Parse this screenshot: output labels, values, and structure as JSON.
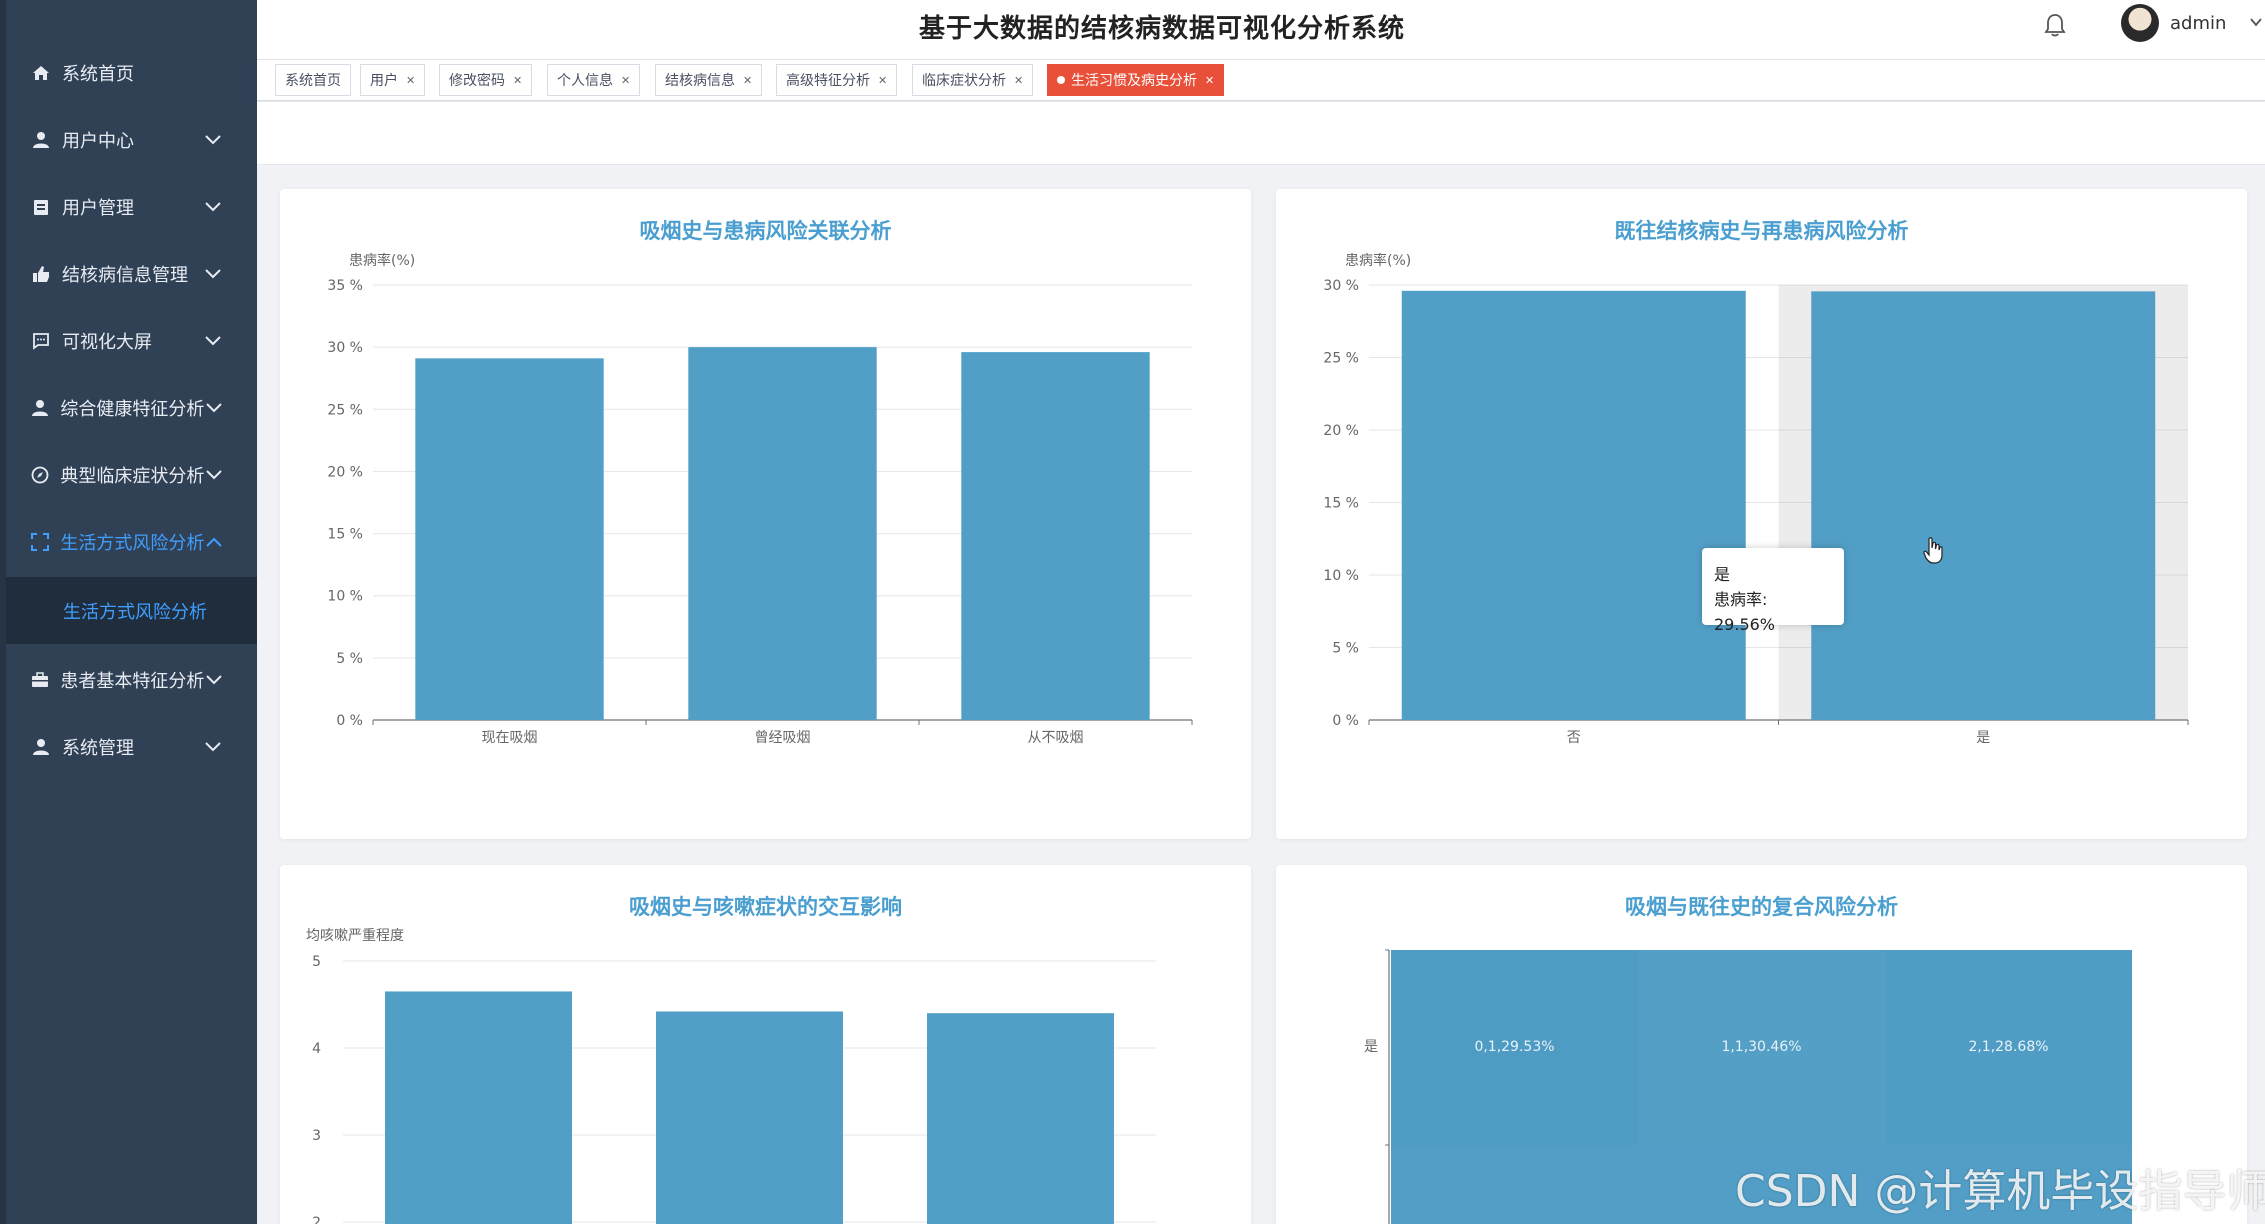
{
  "header": {
    "title": "基于大数据的结核病数据可视化分析系统",
    "username": "admin"
  },
  "sidebar": {
    "items": [
      {
        "label": "系统首页",
        "icon": "home-icon"
      },
      {
        "label": "用户中心",
        "icon": "user-icon"
      },
      {
        "label": "用户管理",
        "icon": "clipboard-icon"
      },
      {
        "label": "结核病信息管理",
        "icon": "thumb-icon"
      },
      {
        "label": "可视化大屏",
        "icon": "message-icon"
      },
      {
        "label": "综合健康特征分析",
        "icon": "user-icon"
      },
      {
        "label": "典型临床症状分析",
        "icon": "compass-icon"
      },
      {
        "label": "生活方式风险分析",
        "icon": "fullscreen-icon"
      },
      {
        "label": "患者基本特征分析",
        "icon": "suitcase-icon"
      },
      {
        "label": "系统管理",
        "icon": "user-icon"
      }
    ],
    "sub_item": "生活方式风险分析"
  },
  "tags": [
    {
      "label": "系统首页"
    },
    {
      "label": "用户"
    },
    {
      "label": "修改密码"
    },
    {
      "label": "个人信息"
    },
    {
      "label": "结核病信息"
    },
    {
      "label": "高级特征分析"
    },
    {
      "label": "临床症状分析"
    },
    {
      "label": "生活习惯及病史分析"
    }
  ],
  "colors": {
    "bar": "#519fc7",
    "title": "#4a9fd0",
    "sidebar": "#304156",
    "active_tag": "#e8503a",
    "active_menu": "#409eff"
  },
  "watermark": "CSDN @计算机毕设指导师",
  "tooltip": {
    "category": "是",
    "text": "患病率: 29.56%"
  },
  "chart_data": [
    {
      "type": "bar",
      "title": "吸烟史与患病风险关联分析",
      "ylabel": "患病率(%)",
      "categories": [
        "现在吸烟",
        "曾经吸烟",
        "从不吸烟"
      ],
      "values": [
        29.1,
        30.0,
        29.6
      ],
      "ylim": [
        0,
        35
      ],
      "yticks": [
        "0 %",
        "5 %",
        "10 %",
        "15 %",
        "20 %",
        "25 %",
        "30 %",
        "35 %"
      ]
    },
    {
      "type": "bar",
      "title": "既往结核病史与再患病风险分析",
      "ylabel": "患病率(%)",
      "categories": [
        "否",
        "是"
      ],
      "values": [
        29.6,
        29.56
      ],
      "ylim": [
        0,
        30
      ],
      "yticks": [
        "0 %",
        "5 %",
        "10 %",
        "15 %",
        "20 %",
        "25 %",
        "30 %"
      ]
    },
    {
      "type": "bar",
      "title": "吸烟史与咳嗽症状的交互影响",
      "ylabel": "均咳嗽严重程度",
      "values": [
        4.65,
        4.42,
        4.4
      ],
      "yticks": [
        "2",
        "3",
        "4",
        "5"
      ]
    },
    {
      "type": "heatmap",
      "title": "吸烟与既往史的复合风险分析",
      "ylabels": [
        "是"
      ],
      "cells": [
        "0,1,29.53%",
        "1,1,30.46%",
        "2,1,28.68%"
      ]
    }
  ]
}
